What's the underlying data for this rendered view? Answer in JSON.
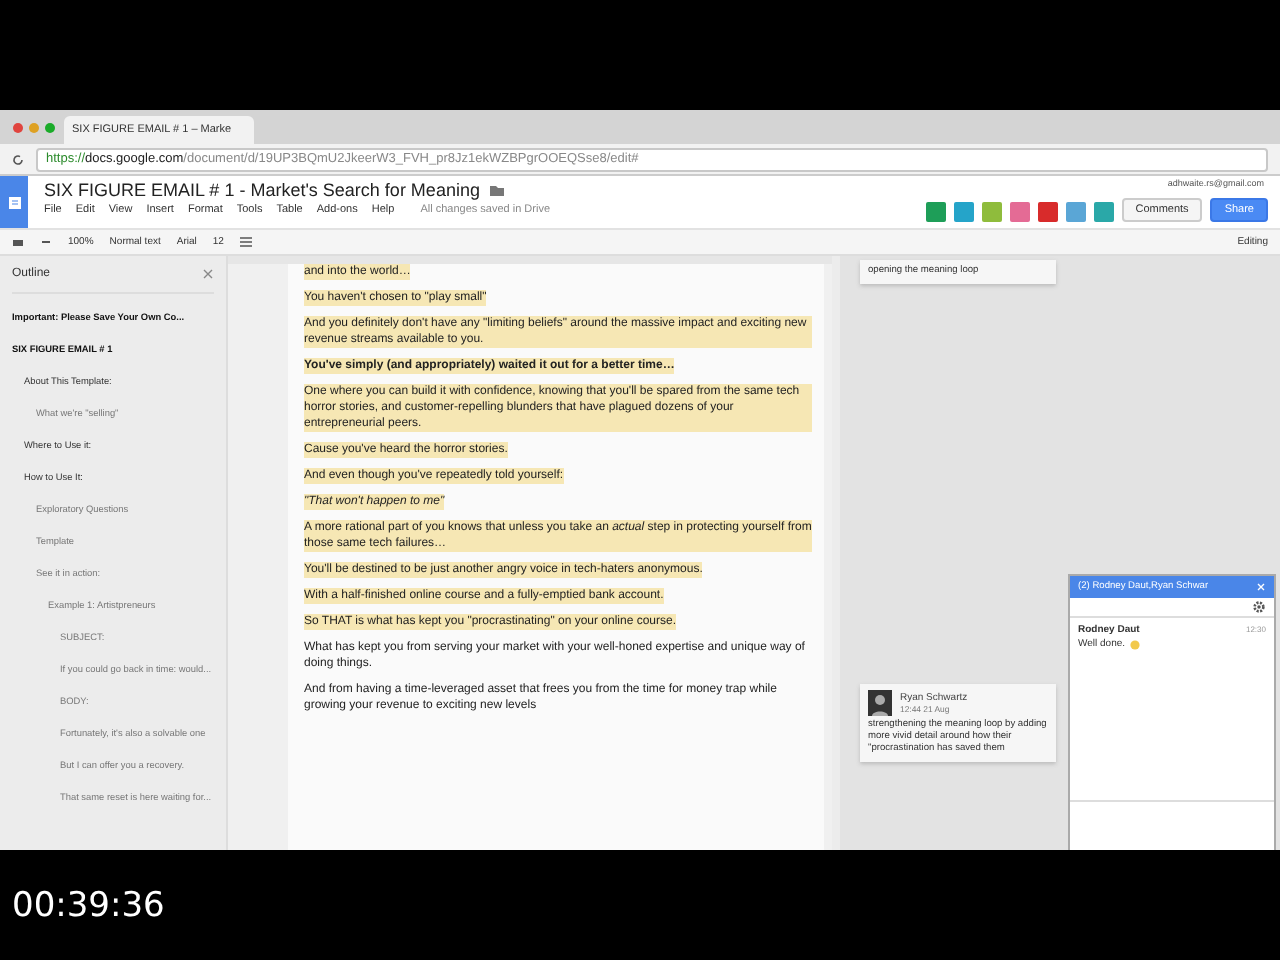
{
  "browser": {
    "tab_title": "SIX FIGURE EMAIL # 1 – Marke",
    "url": {
      "scheme": "https://",
      "host": "docs.google.com",
      "path": "/document/d/19UP3BQmU2JkeerW3_FVH_pr8Jz1ekWZBPgrOOEQSse8/edit#"
    }
  },
  "doc": {
    "title": "SIX FIGURE EMAIL # 1 - Market's Search for Meaning",
    "account": "adhwaite.rs@gmail.com",
    "menus": [
      "File",
      "Edit",
      "View",
      "Insert",
      "Format",
      "Tools",
      "Table",
      "Add-ons",
      "Help"
    ],
    "save_status": "All changes saved in Drive",
    "comments_button": "Comments",
    "share_button": "Share",
    "toolbar": {
      "zoom": "100%",
      "style": "Normal text",
      "font": "Arial",
      "size": "12",
      "mode": "Editing"
    }
  },
  "outline": {
    "title": "Outline",
    "items": [
      {
        "label": "Important: Please Save Your Own Co..."
      },
      {
        "label": "SIX FIGURE EMAIL # 1",
        "children": [
          {
            "label": "About This Template:",
            "children": [
              {
                "label": "What we're \"selling\""
              }
            ]
          },
          {
            "label": "Where to Use it:"
          },
          {
            "label": "How to Use It:",
            "children": [
              {
                "label": "Exploratory Questions"
              },
              {
                "label": "Template"
              },
              {
                "label": "See it in action:",
                "children": [
                  {
                    "label": "Example 1: Artistpreneurs",
                    "children": [
                      {
                        "label": "SUBJECT:"
                      },
                      {
                        "label": "If you could go back in time: would..."
                      },
                      {
                        "label": "BODY:"
                      },
                      {
                        "label": "Fortunately, it's also a solvable one"
                      },
                      {
                        "label": "But I can offer you a recovery."
                      },
                      {
                        "label": "That same reset is here waiting for..."
                      }
                    ]
                  }
                ]
              }
            ]
          }
        ]
      }
    ]
  },
  "paragraphs": [
    {
      "text": "and into the world…",
      "kind": "plain",
      "highlighted": true
    },
    {
      "text": "You haven't chosen to \"play small\"",
      "kind": "plain",
      "highlighted": true
    },
    {
      "text": "And you definitely don't have any \"limiting beliefs\" around the massive impact and exciting new revenue streams available to you.",
      "kind": "plain",
      "highlighted": true
    },
    {
      "text": "You've simply (and appropriately) waited it out for a better time…",
      "kind": "bold",
      "highlighted": true
    },
    {
      "text": "One where you can build it with confidence, knowing that you'll be spared from the same tech horror stories, and customer-repelling blunders that have plagued dozens of your entrepreneurial peers.",
      "kind": "plain",
      "highlighted": true
    },
    {
      "text": "Cause you've heard the horror stories.",
      "kind": "plain",
      "highlighted": true
    },
    {
      "text": "And even though you've repeatedly told yourself:",
      "kind": "plain",
      "highlighted": true
    },
    {
      "text": "\"That won't happen to me\"",
      "kind": "italic",
      "highlighted": true
    },
    {
      "text": "A more rational part of you knows that unless you take an *actual* step in protecting yourself from those same tech failures…",
      "kind": "plain",
      "highlighted": true
    },
    {
      "text": "You'll be destined to be just another angry voice in tech-haters anonymous.",
      "kind": "plain",
      "highlighted": true
    },
    {
      "text": "With a half-finished online course and a fully-emptied bank account.",
      "kind": "plain",
      "highlighted": true
    },
    {
      "text": "So THAT is what has kept you \"procrastinating\" on your online course.",
      "kind": "plain",
      "highlighted": true
    },
    {
      "text": "What has kept you from serving your market with your well-honed expertise and unique way of doing things.",
      "kind": "plain",
      "highlighted": false
    },
    {
      "text": "And from having a time-leveraged asset that frees you from the time for money trap while growing your revenue to exciting new levels",
      "kind": "plain",
      "highlighted": false
    }
  ],
  "comments": [
    {
      "text": "opening the meaning loop"
    },
    {
      "author": "Ryan Schwartz",
      "time": "12:44 21 Aug",
      "text": "strengthening the meaning loop by adding more vivid detail around how their \"procrastination has saved them"
    }
  ],
  "chat": {
    "title": "(2) Rodney Daut,Ryan Schwar",
    "messages": [
      {
        "author": "Rodney Daut",
        "time": "12:30",
        "text": "Well done."
      }
    ]
  },
  "video": {
    "timestamp": "00:39:36"
  }
}
